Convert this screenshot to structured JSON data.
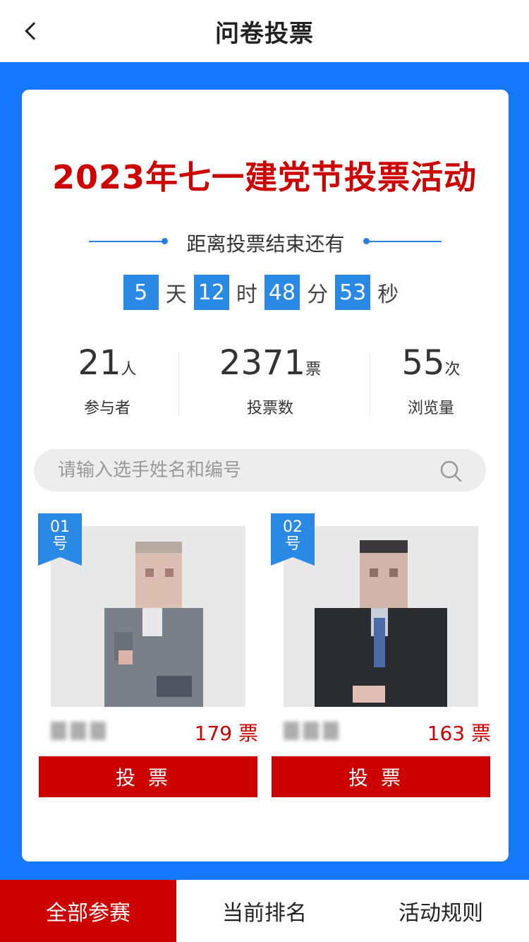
{
  "header": {
    "title": "问卷投票"
  },
  "event": {
    "title": "2023年七一建党节投票活动"
  },
  "countdown": {
    "label": "距离投票结束还有",
    "days": "5",
    "days_unit": "天",
    "hours": "12",
    "hours_unit": "时",
    "minutes": "48",
    "minutes_unit": "分",
    "seconds": "53",
    "seconds_unit": "秒"
  },
  "stats": [
    {
      "value": "21",
      "unit": "人",
      "label": "参与者"
    },
    {
      "value": "2371",
      "unit": "票",
      "label": "投票数"
    },
    {
      "value": "55",
      "unit": "次",
      "label": "浏览量"
    }
  ],
  "search": {
    "placeholder": "请输入选手姓名和编号"
  },
  "players": [
    {
      "number": "01",
      "number_suffix": "号",
      "votes": "179 票",
      "button": "投票",
      "suit_color": "#7a8088"
    },
    {
      "number": "02",
      "number_suffix": "号",
      "votes": "163 票",
      "button": "投票",
      "suit_color": "#2a2c30"
    }
  ],
  "tabs": [
    {
      "label": "全部参赛",
      "active": true
    },
    {
      "label": "当前排名",
      "active": false
    },
    {
      "label": "活动规则",
      "active": false
    }
  ],
  "colors": {
    "brand_red": "#cc0000",
    "brand_blue": "#1677ff",
    "accent_blue": "#2b89e6"
  }
}
